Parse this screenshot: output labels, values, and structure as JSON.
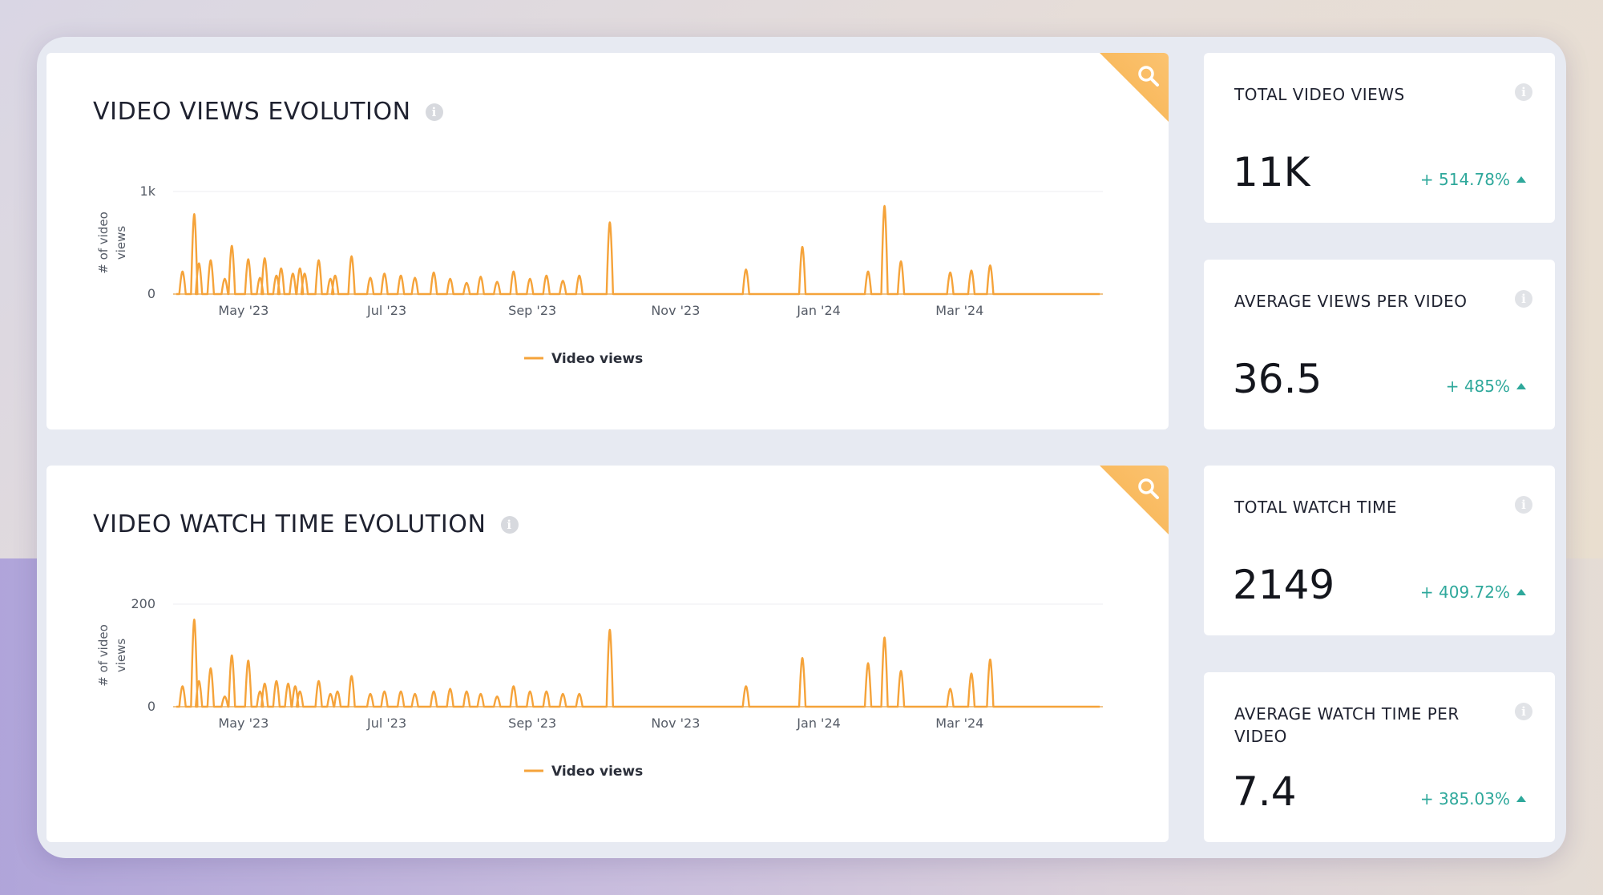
{
  "colors": {
    "accent": "#f5a33a",
    "positive": "#2ea89b",
    "corner": "#f7b24e"
  },
  "charts": {
    "views": {
      "title": "VIDEO VIEWS EVOLUTION",
      "icon": "search-icon",
      "legend": "Video views"
    },
    "watch": {
      "title": "VIDEO WATCH TIME EVOLUTION",
      "icon": "search-icon",
      "legend": "Video views"
    }
  },
  "chart_data": [
    {
      "type": "line",
      "ylabel": "# of video views",
      "ylim": [
        0,
        1000
      ],
      "y_ticks": [
        "0",
        "1k"
      ],
      "x_ticks": [
        "May '23",
        "Jul '23",
        "Sep '23",
        "Nov '23",
        "Jan '24",
        "Mar '24"
      ],
      "x_range": [
        "2023-04-01",
        "2024-05-01"
      ],
      "grid": true,
      "legend_position": "bottom",
      "series": [
        {
          "name": "Video views",
          "points": [
            [
              "2023-04-05",
              220
            ],
            [
              "2023-04-10",
              780
            ],
            [
              "2023-04-12",
              300
            ],
            [
              "2023-04-17",
              330
            ],
            [
              "2023-04-23",
              150
            ],
            [
              "2023-04-26",
              470
            ],
            [
              "2023-05-03",
              340
            ],
            [
              "2023-05-08",
              160
            ],
            [
              "2023-05-10",
              350
            ],
            [
              "2023-05-15",
              180
            ],
            [
              "2023-05-17",
              250
            ],
            [
              "2023-05-22",
              200
            ],
            [
              "2023-05-25",
              250
            ],
            [
              "2023-05-27",
              200
            ],
            [
              "2023-06-02",
              330
            ],
            [
              "2023-06-07",
              150
            ],
            [
              "2023-06-09",
              180
            ],
            [
              "2023-06-16",
              370
            ],
            [
              "2023-06-24",
              160
            ],
            [
              "2023-06-30",
              200
            ],
            [
              "2023-07-07",
              180
            ],
            [
              "2023-07-13",
              160
            ],
            [
              "2023-07-21",
              210
            ],
            [
              "2023-07-28",
              150
            ],
            [
              "2023-08-04",
              110
            ],
            [
              "2023-08-10",
              170
            ],
            [
              "2023-08-17",
              120
            ],
            [
              "2023-08-24",
              220
            ],
            [
              "2023-08-31",
              150
            ],
            [
              "2023-09-07",
              180
            ],
            [
              "2023-09-14",
              130
            ],
            [
              "2023-09-21",
              180
            ],
            [
              "2023-10-04",
              700
            ],
            [
              "2023-12-01",
              240
            ],
            [
              "2023-12-25",
              460
            ],
            [
              "2024-01-22",
              220
            ],
            [
              "2024-01-29",
              860
            ],
            [
              "2024-02-05",
              320
            ],
            [
              "2024-02-26",
              210
            ],
            [
              "2024-03-06",
              230
            ],
            [
              "2024-03-14",
              280
            ]
          ]
        }
      ]
    },
    {
      "type": "line",
      "ylabel": "# of video views",
      "ylim": [
        0,
        200
      ],
      "y_ticks": [
        "0",
        "200"
      ],
      "x_ticks": [
        "May '23",
        "Jul '23",
        "Sep '23",
        "Nov '23",
        "Jan '24",
        "Mar '24"
      ],
      "x_range": [
        "2023-04-01",
        "2024-05-01"
      ],
      "grid": true,
      "legend_position": "bottom",
      "series": [
        {
          "name": "Video views",
          "points": [
            [
              "2023-04-05",
              40
            ],
            [
              "2023-04-10",
              170
            ],
            [
              "2023-04-12",
              50
            ],
            [
              "2023-04-17",
              75
            ],
            [
              "2023-04-23",
              20
            ],
            [
              "2023-04-26",
              100
            ],
            [
              "2023-05-03",
              90
            ],
            [
              "2023-05-08",
              30
            ],
            [
              "2023-05-10",
              45
            ],
            [
              "2023-05-15",
              50
            ],
            [
              "2023-05-20",
              45
            ],
            [
              "2023-05-23",
              40
            ],
            [
              "2023-05-25",
              30
            ],
            [
              "2023-06-02",
              50
            ],
            [
              "2023-06-07",
              25
            ],
            [
              "2023-06-10",
              30
            ],
            [
              "2023-06-16",
              60
            ],
            [
              "2023-06-24",
              25
            ],
            [
              "2023-06-30",
              30
            ],
            [
              "2023-07-07",
              30
            ],
            [
              "2023-07-13",
              25
            ],
            [
              "2023-07-21",
              30
            ],
            [
              "2023-07-28",
              35
            ],
            [
              "2023-08-04",
              30
            ],
            [
              "2023-08-10",
              25
            ],
            [
              "2023-08-17",
              20
            ],
            [
              "2023-08-24",
              40
            ],
            [
              "2023-08-31",
              30
            ],
            [
              "2023-09-07",
              30
            ],
            [
              "2023-09-14",
              25
            ],
            [
              "2023-09-21",
              25
            ],
            [
              "2023-10-04",
              150
            ],
            [
              "2023-12-01",
              40
            ],
            [
              "2023-12-25",
              95
            ],
            [
              "2024-01-22",
              85
            ],
            [
              "2024-01-29",
              135
            ],
            [
              "2024-02-05",
              70
            ],
            [
              "2024-02-26",
              35
            ],
            [
              "2024-03-06",
              65
            ],
            [
              "2024-03-14",
              92
            ]
          ]
        }
      ]
    }
  ],
  "kpis": [
    {
      "title": "TOTAL VIDEO VIEWS",
      "value": "11K",
      "change": "+ 514.78%"
    },
    {
      "title": "AVERAGE VIEWS PER VIDEO",
      "value": "36.5",
      "change": "+ 485%"
    },
    {
      "title": "TOTAL WATCH TIME",
      "value": "2149",
      "change": "+ 409.72%"
    },
    {
      "title": "AVERAGE WATCH TIME PER VIDEO",
      "value": "7.4",
      "change": "+ 385.03%"
    }
  ]
}
